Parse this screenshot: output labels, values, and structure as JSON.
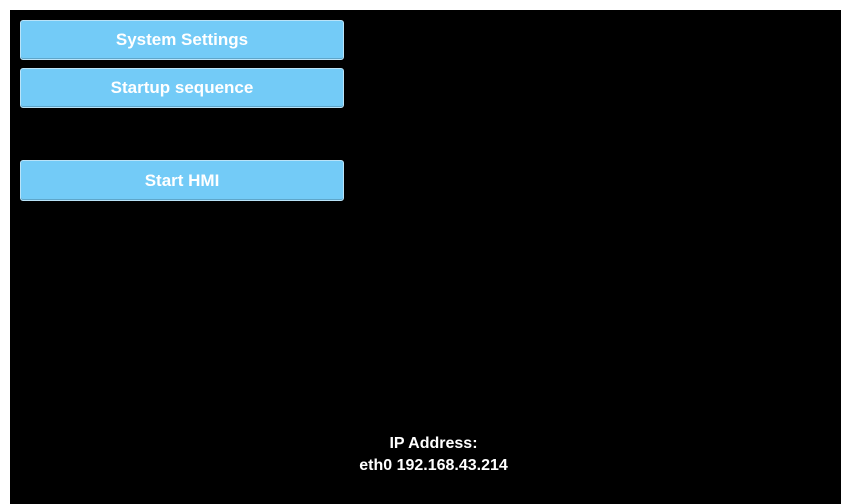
{
  "menu": {
    "system_settings_label": "System Settings",
    "startup_sequence_label": "Startup sequence",
    "start_hmi_label": "Start HMI"
  },
  "network": {
    "ip_address_label": "IP Address:",
    "interface_line": "eth0 192.168.43.214"
  },
  "colors": {
    "background": "#000000",
    "button_fill": "#73cbf7",
    "button_text": "#ffffff",
    "status_text": "#ffffff"
  }
}
